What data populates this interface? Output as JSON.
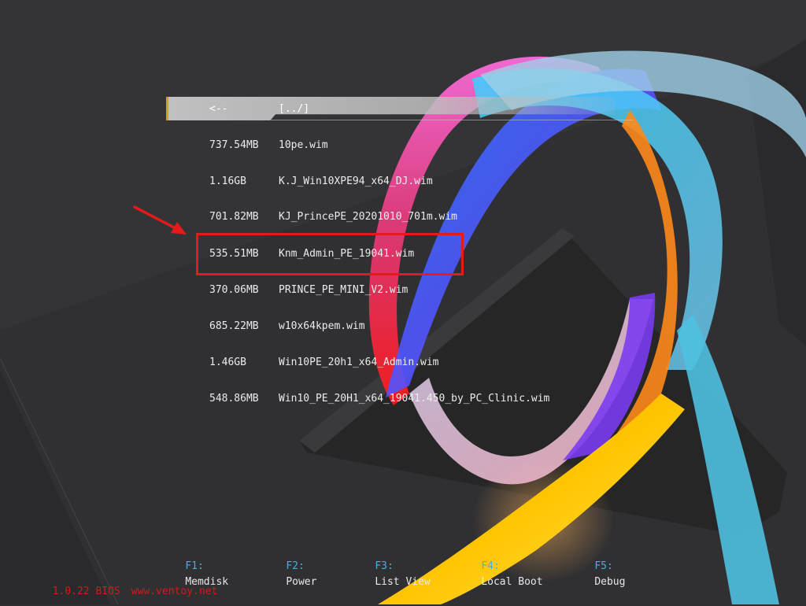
{
  "colors": {
    "selection_bar": "#c8c8c8",
    "selection_accent": "#d4a020",
    "highlight_box": "#e51a1a",
    "hotkey_key": "#3ab6e0",
    "version_text": "#d21a1a"
  },
  "file_list": {
    "selected_index": 0,
    "rows": [
      {
        "size": "<--",
        "name": "[../]"
      },
      {
        "size": "737.54MB",
        "name": "10pe.wim"
      },
      {
        "size": "1.16GB",
        "name": "K.J_Win10XPE94_x64_DJ.wim"
      },
      {
        "size": "701.82MB",
        "name": "KJ_PrincePE_20201010_701m.wim"
      },
      {
        "size": "535.51MB",
        "name": "Knm_Admin_PE_19041.wim"
      },
      {
        "size": "370.06MB",
        "name": "PRINCE_PE_MINI_V2.wim"
      },
      {
        "size": "685.22MB",
        "name": "w10x64kpem.wim"
      },
      {
        "size": "1.46GB",
        "name": "Win10PE_20h1_x64_Admin.wim"
      },
      {
        "size": "548.86MB",
        "name": "Win10_PE_20H1_x64_19041.450_by_PC_Clinic.wim"
      }
    ]
  },
  "annotation": {
    "highlighted_row": 4,
    "arrow_icon": "red-arrow-icon"
  },
  "hotkeys": [
    {
      "key": "F1:",
      "label": "Memdisk"
    },
    {
      "key": "F2:",
      "label": "Power"
    },
    {
      "key": "F3:",
      "label": "List View"
    },
    {
      "key": "F4:",
      "label": "Local Boot"
    },
    {
      "key": "F5:",
      "label": "Debug"
    }
  ],
  "footer": {
    "version": "1.0.22 BIOS",
    "website": "www.ventoy.net"
  }
}
